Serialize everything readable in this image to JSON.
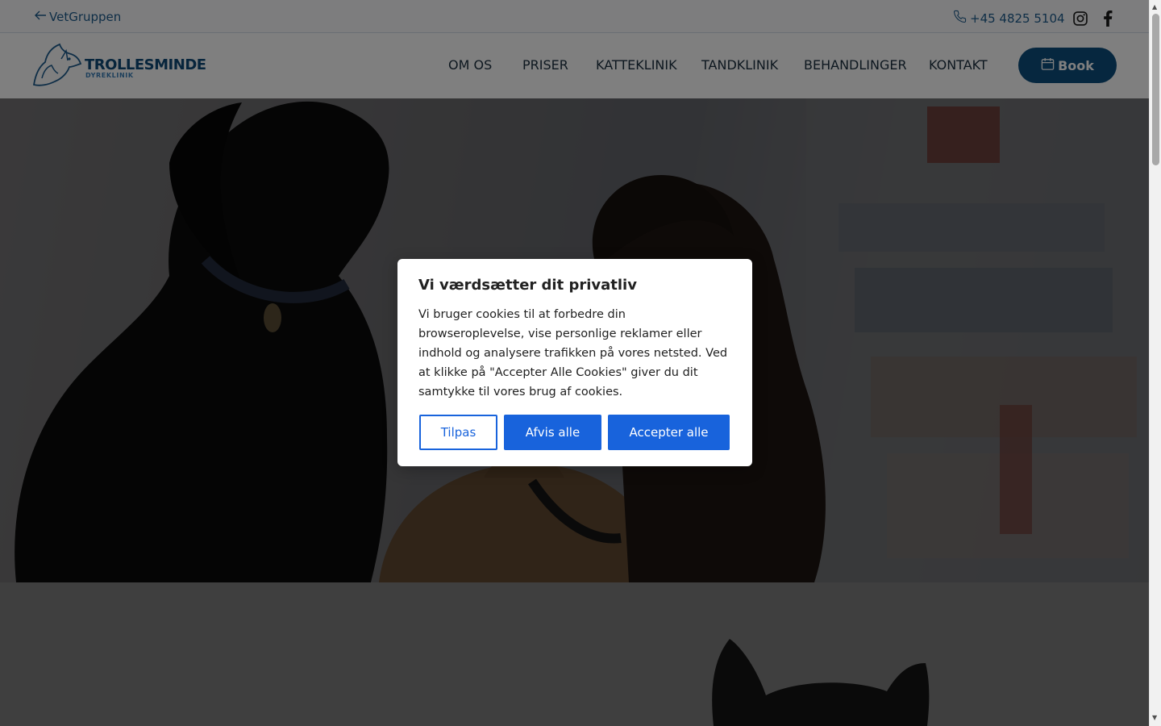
{
  "topbar": {
    "back_label": "VetGruppen",
    "phone": "+45 4825 5104",
    "social": [
      "instagram-icon",
      "facebook-icon"
    ]
  },
  "header": {
    "logo_title": "TROLLESMINDE",
    "logo_subtitle": "DYREKLINIK",
    "nav": [
      "OM OS",
      "PRISER",
      "KATTEKLINIK",
      "TANDKLINIK",
      "BEHANDLINGER",
      "KONTAKT"
    ],
    "book_label": "Book"
  },
  "cookie": {
    "title": "Vi værdsætter dit privatliv",
    "text": "Vi bruger cookies til at forbedre din browseroplevelse, vise personlige reklamer eller indhold og analysere trafikken på vores netsted. Ved at klikke på \"Accepter Alle Cookies\" giver du dit samtykke til vores brug af cookies.",
    "customize": "Tilpas",
    "reject": "Afvis alle",
    "accept": "Accepter alle"
  },
  "colors": {
    "brand": "#0c4e7e",
    "cookie_blue": "#1863dc"
  }
}
